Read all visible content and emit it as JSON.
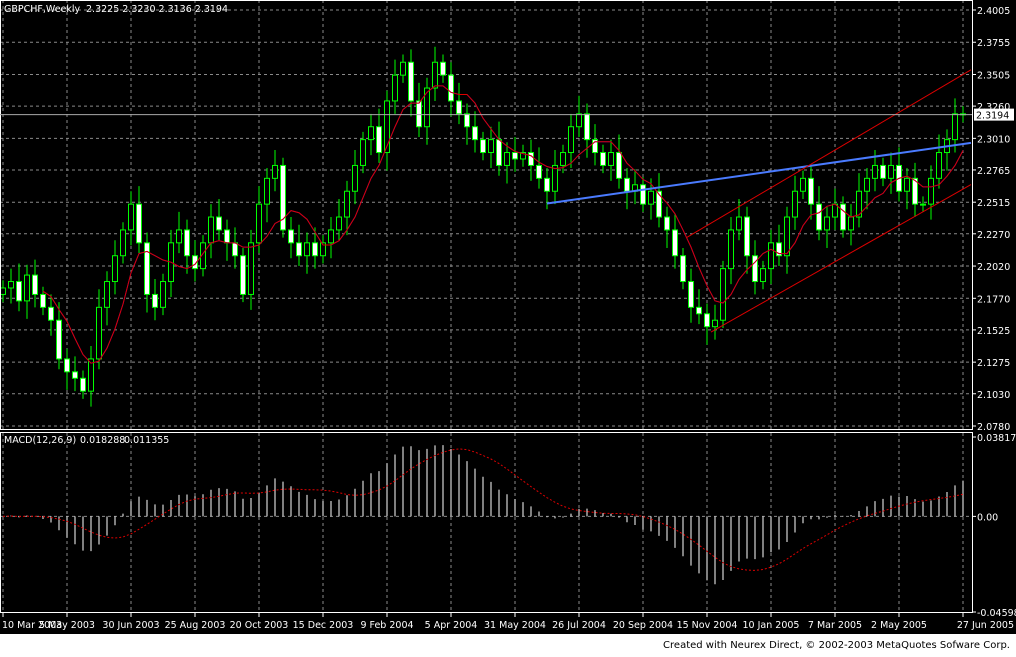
{
  "chart_data": {
    "type": "candlestick",
    "symbol_label": "GBPCHF,Weekly",
    "ohlc_label": [
      "2.3225",
      "2.3230",
      "2.3136",
      "2.3194"
    ],
    "current_price": 2.3194,
    "current_price_label": "2.3194",
    "ylim": [
      2.078,
      2.4005
    ],
    "y_ticks": [
      "2.4005",
      "2.3755",
      "2.3505",
      "2.3260",
      "2.3010",
      "2.2765",
      "2.2515",
      "2.2270",
      "2.2020",
      "2.1770",
      "2.1525",
      "2.1275",
      "2.1030",
      "2.0780"
    ],
    "x_ticks": [
      "10 Mar 2003",
      "5 May 2003",
      "30 Jun 2003",
      "25 Aug 2003",
      "20 Oct 2003",
      "15 Dec 2003",
      "9 Feb 2004",
      "5 Apr 2004",
      "31 May 2004",
      "26 Jul 2004",
      "20 Sep 2004",
      "15 Nov 2004",
      "10 Jan 2005",
      "7 Mar 2005",
      "2 May 2005",
      "27 Jun 2005"
    ],
    "closes": [
      2.185,
      2.19,
      2.175,
      2.195,
      2.18,
      2.17,
      2.16,
      2.13,
      2.12,
      2.115,
      2.105,
      2.13,
      2.17,
      2.19,
      2.21,
      2.23,
      2.25,
      2.22,
      2.18,
      2.17,
      2.19,
      2.22,
      2.23,
      2.21,
      2.2,
      2.22,
      2.24,
      2.23,
      2.22,
      2.21,
      2.18,
      2.22,
      2.25,
      2.27,
      2.28,
      2.23,
      2.22,
      2.21,
      2.22,
      2.21,
      2.22,
      2.23,
      2.24,
      2.26,
      2.28,
      2.3,
      2.31,
      2.29,
      2.33,
      2.35,
      2.36,
      2.33,
      2.31,
      2.34,
      2.36,
      2.35,
      2.33,
      2.32,
      2.31,
      2.3,
      2.29,
      2.3,
      2.28,
      2.29,
      2.285,
      2.29,
      2.28,
      2.27,
      2.26,
      2.28,
      2.29,
      2.31,
      2.32,
      2.3,
      2.29,
      2.28,
      2.29,
      2.27,
      2.26,
      2.265,
      2.25,
      2.26,
      2.24,
      2.23,
      2.21,
      2.19,
      2.17,
      2.165,
      2.155,
      2.16,
      2.2,
      2.23,
      2.24,
      2.21,
      2.19,
      2.2,
      2.22,
      2.21,
      2.24,
      2.26,
      2.27,
      2.25,
      2.23,
      2.24,
      2.25,
      2.23,
      2.24,
      2.26,
      2.27,
      2.28,
      2.27,
      2.28,
      2.26,
      2.27,
      2.25,
      2.25,
      2.27,
      2.29,
      2.3,
      2.32,
      2.3194
    ],
    "first_open": 2.18,
    "ma_fast_period": 10,
    "ma_slow_period": 21,
    "colors": {
      "candle": "#00ff00",
      "ma_fast": "#0000cc",
      "ma_slow": "#dd0000",
      "trendline": "#4a7bff",
      "channel": "#dd0000",
      "grid": "#8a8a8a"
    },
    "trendlines": [
      {
        "name": "blue-trendline",
        "from": [
          68,
          2.2505
        ],
        "to": [
          121,
          2.2975
        ]
      },
      {
        "name": "channel-lower",
        "from": [
          88.5,
          2.1508
        ],
        "to": [
          121,
          2.2652
        ]
      },
      {
        "name": "channel-upper",
        "from": [
          85.5,
          2.2243
        ],
        "to": [
          121,
          2.3541
        ]
      }
    ],
    "macd": {
      "label": "MACD(12,26,9)",
      "value_label": "0.018288",
      "signal_label": "0.011355",
      "params": [
        12,
        26,
        9
      ],
      "ylim": [
        -0.04598,
        0.03817
      ],
      "y_ticks": [
        "0.03817",
        "0.00",
        "-0.04598"
      ]
    }
  },
  "footer": "Created with Neurex Direct, © 2002-2003 MetaQuotes Sofware Corp."
}
